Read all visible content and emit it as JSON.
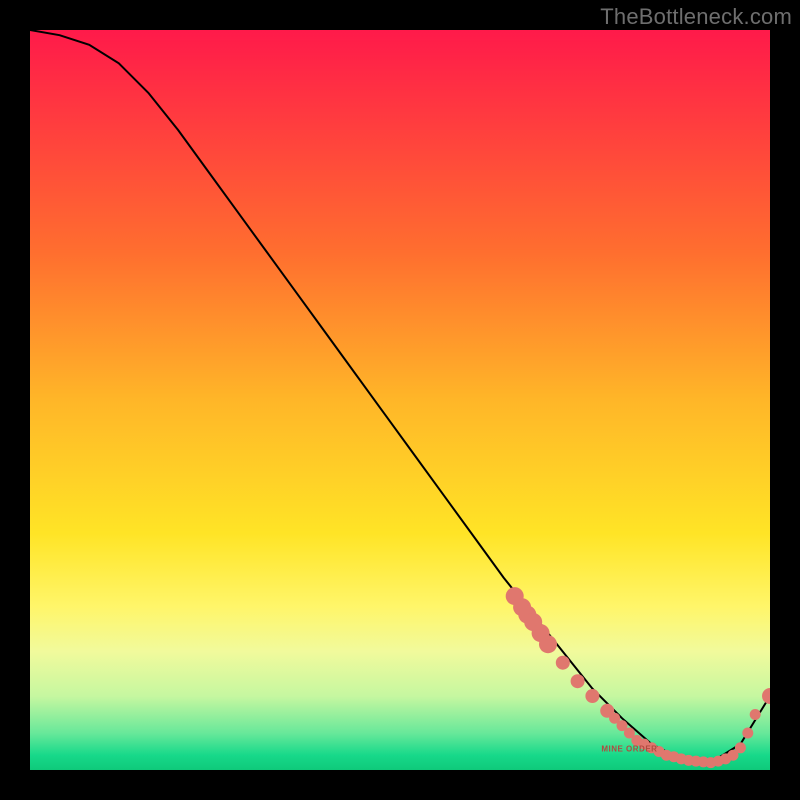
{
  "watermark": "TheBottleneck.com",
  "chart_data": {
    "type": "line",
    "title": "",
    "xlabel": "",
    "ylabel": "",
    "xlim": [
      0,
      100
    ],
    "ylim": [
      0,
      100
    ],
    "grid": false,
    "x": [
      0,
      4,
      8,
      12,
      16,
      20,
      24,
      28,
      32,
      36,
      40,
      44,
      48,
      52,
      56,
      60,
      64,
      68,
      72,
      76,
      80,
      84,
      88,
      92,
      96,
      100
    ],
    "values": [
      100,
      99.3,
      98.0,
      95.5,
      91.5,
      86.5,
      81.0,
      75.5,
      70.0,
      64.5,
      59.0,
      53.5,
      48.0,
      42.5,
      37.0,
      31.5,
      26.0,
      21.0,
      16.0,
      11.0,
      7.0,
      3.5,
      1.5,
      1.0,
      3.5,
      10.0
    ],
    "markers": {
      "x": [
        65.5,
        66.5,
        67.2,
        68.0,
        69.0,
        70.0,
        72.0,
        74.0,
        76.0,
        78.0,
        79.0,
        80.0,
        81.0,
        82.0,
        83.0,
        84.0,
        85.0,
        86.0,
        87.0,
        88.0,
        89.0,
        90.0,
        91.0,
        92.0,
        93.0,
        94.0,
        95.0,
        96.0,
        97.0,
        98.0,
        100.0
      ],
      "y": [
        23.5,
        22.0,
        21.0,
        20.0,
        18.5,
        17.0,
        14.5,
        12.0,
        10.0,
        8.0,
        7.0,
        6.0,
        5.0,
        4.0,
        3.5,
        3.0,
        2.5,
        2.0,
        1.8,
        1.5,
        1.3,
        1.2,
        1.1,
        1.0,
        1.2,
        1.5,
        2.0,
        3.0,
        5.0,
        7.5,
        10.0
      ]
    },
    "annotation": {
      "x": 81,
      "y": 2.5,
      "text": "MINE ORDER"
    }
  },
  "colors": {
    "background": "#000000",
    "curve": "#000000",
    "marker": "#e0776e",
    "gradient_top": "#ff1a4a",
    "gradient_bottom": "#0fc97a",
    "watermark": "#6e6e6e"
  }
}
